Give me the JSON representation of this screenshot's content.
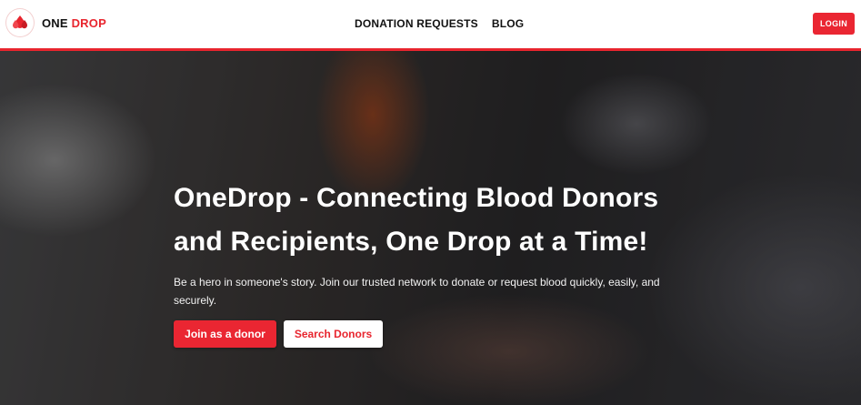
{
  "brand": {
    "name_part1": "ONE",
    "name_part2": "DROP",
    "accent_color": "#e8252e"
  },
  "nav": {
    "links": [
      "DONATION REQUESTS",
      "BLOG"
    ],
    "login_label": "LOGIN"
  },
  "hero": {
    "title": "OneDrop - Connecting Blood Donors and Recipients, One Drop at a Time!",
    "subtitle": "Be a hero in someone's story. Join our trusted network to donate or request blood quickly, easily, and securely.",
    "primary_cta": "Join as a donor",
    "secondary_cta": "Search Donors"
  }
}
